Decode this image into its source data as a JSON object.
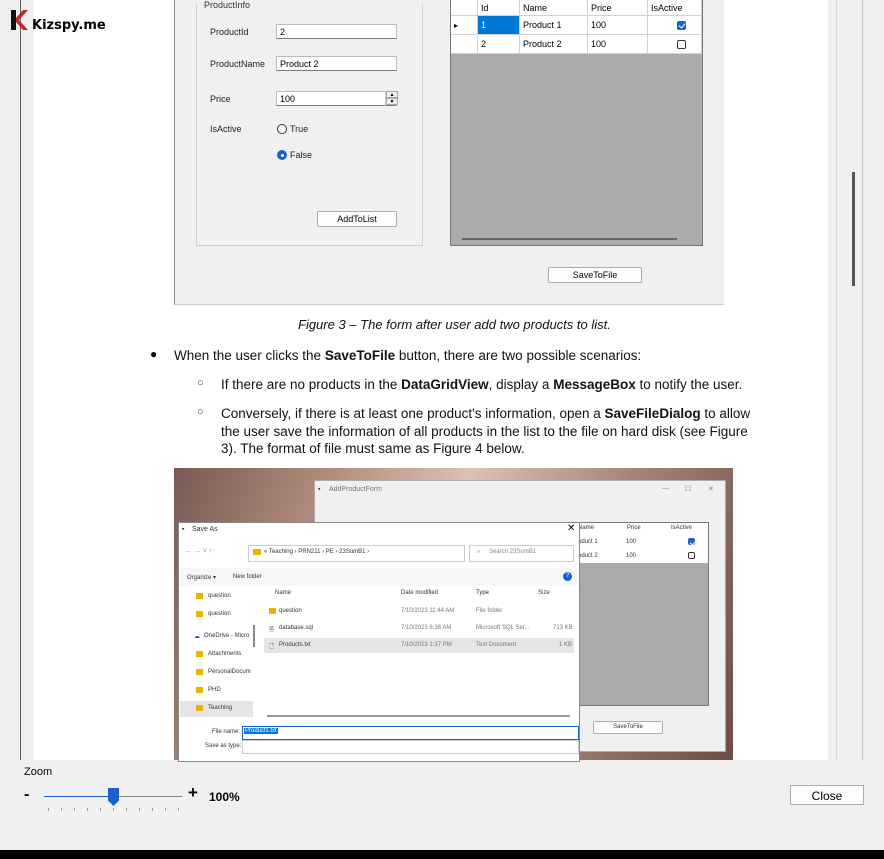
{
  "brand": {
    "name": "Kizspy.me",
    "color": "#c62828"
  },
  "figure3": {
    "group_title": "ProductInfo",
    "labels": {
      "id": "ProductId",
      "name": "ProductName",
      "price": "Price",
      "active": "IsActive"
    },
    "values": {
      "id": "2",
      "name": "Product 2",
      "price": "100"
    },
    "radios": {
      "true_label": "True",
      "false_label": "False",
      "selected": "False"
    },
    "add_button": "AddToList",
    "grid": {
      "columns": [
        "Id",
        "Name",
        "Price",
        "IsActive"
      ],
      "rows": [
        {
          "id": "1",
          "name": "Product 1",
          "price": "100",
          "active": true
        },
        {
          "id": "2",
          "name": "Product 2",
          "price": "100",
          "active": false
        }
      ]
    },
    "save_button": "SaveToFile",
    "caption": "Figure 3 – The form after user add two products to list."
  },
  "text": {
    "bullet1_pre": "When the user clicks the ",
    "bullet1_bold": "SaveToFile",
    "bullet1_post": " button, there are two possible scenarios:",
    "sub1_pre": "If there are no products in the ",
    "sub1_bold1": "DataGridView",
    "sub1_mid": ", display a ",
    "sub1_bold2": "MessageBox",
    "sub1_post": " to notify the user.",
    "sub2_line1_pre": "Conversely, if there is at least one product's information, open a ",
    "sub2_bold": "SaveFileDialog",
    "sub2_line1_post": " to allow",
    "sub2_line2": "the user save the information of all products in the list to the   file on hard disk (see Figure",
    "sub2_line3": "3). The format of file must same as Figure 4 below."
  },
  "figure4": {
    "form_title": "AddProductForm",
    "grid_columns": [
      "Name",
      "Price",
      "IsActive"
    ],
    "grid_rows": [
      {
        "name": "oduct 1",
        "price": "100",
        "active": true
      },
      {
        "name": "oduct 2",
        "price": "100",
        "active": false
      }
    ],
    "save_button": "SaveToFile",
    "dialog": {
      "title": "Save As",
      "breadcrumb": "« Teaching  ›  PRN211  ›  PE  ›  23SumB1  ›",
      "search_placeholder": "Search 23SumB1",
      "organize": "Organize ▾",
      "new_folder": "New folder",
      "nav": [
        "question",
        "question",
        "OneDrive - Micro",
        "Attachments",
        "PersonalDocum",
        "PHD",
        "Teaching"
      ],
      "columns": [
        "Name",
        "Date modified",
        "Type",
        "Size"
      ],
      "files": [
        {
          "name": "question",
          "date": "7/10/2023 11:44 AM",
          "type": "File folder",
          "size": ""
        },
        {
          "name": "database.sql",
          "date": "7/10/2023 8:36 AM",
          "type": "Microsoft SQL Ser...",
          "size": "713 KB"
        },
        {
          "name": "Products.txt",
          "date": "7/10/2023 1:37 PM",
          "type": "Text Document",
          "size": "1 KB"
        }
      ],
      "file_name_label": "File name:",
      "file_name_value": "Products.txt",
      "save_type_label": "Save as type:"
    }
  },
  "zoom": {
    "label": "Zoom",
    "minus": "-",
    "plus": "+",
    "percent": "100%",
    "level": 0.5
  },
  "close_button": "Close",
  "colors": {
    "accent": "#1a62c9",
    "selection": "#0078d7"
  }
}
